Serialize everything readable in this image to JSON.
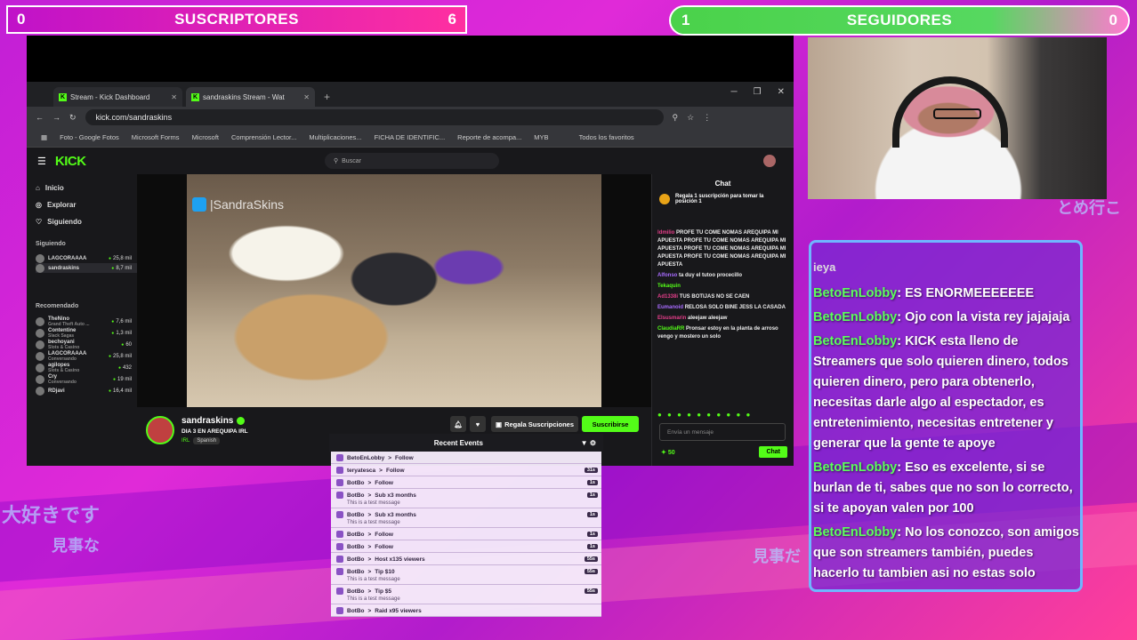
{
  "colors": {
    "kick_green": "#53fc18",
    "overlay_chat_border": "#6fb6ff",
    "username_green": "#5cff5c"
  },
  "counters": {
    "subs": {
      "left": "0",
      "label": "SUSCRIPTORES",
      "right": "6"
    },
    "follows": {
      "left": "1",
      "label": "SEGUIDORES",
      "right": "0"
    }
  },
  "browser": {
    "tabs": [
      {
        "label": "Stream - Kick Dashboard"
      },
      {
        "label": "sandraskins Stream - Wat"
      }
    ],
    "url": "kick.com/sandraskins",
    "bookmarks": [
      "Foto - Google Fotos",
      "Microsoft Forms",
      "Microsoft",
      "Comprensión Lector...",
      "Multiplicaciones...",
      "FICHA DE IDENTIFIC...",
      "Reporte de acompa...",
      "MYB",
      "Todos los favoritos"
    ]
  },
  "kick": {
    "logo": "KICK",
    "search_placeholder": "Buscar",
    "nav": [
      "Inicio",
      "Explorar",
      "Siguiendo"
    ],
    "following_title": "Siguiendo",
    "following": [
      {
        "name": "LAGCORAAAA",
        "count": "25,8 mil"
      },
      {
        "name": "sandraskins",
        "count": "8,7 mil"
      }
    ],
    "recommended_title": "Recomendado",
    "recommended": [
      {
        "name": "TheNino",
        "sub": "Grand Theft Auto ...",
        "count": "7,6 mil"
      },
      {
        "name": "Contentine",
        "sub": "Slack Sagas",
        "count": "1,3 mil"
      },
      {
        "name": "bechoyani",
        "sub": "Slots & Casino",
        "count": "60"
      },
      {
        "name": "LAGCORAAAA",
        "sub": "Conversando",
        "count": "25,8 mil"
      },
      {
        "name": "agilopes",
        "sub": "Slots & Casino",
        "count": "432"
      },
      {
        "name": "Cry",
        "sub": "Conversando",
        "count": "19 mil"
      },
      {
        "name": "RDjavi",
        "sub": "",
        "count": "16,4 mil"
      }
    ],
    "video_watermark": "|SandraSkins",
    "streamer": {
      "name": "sandraskins",
      "title": "DIA 3 EN AREQUIPA IRL",
      "category": "IRL",
      "tag": "Spanish",
      "gift_label": "Regala Suscripciones",
      "subscribe_label": "Suscribirse"
    },
    "chat": {
      "title": "Chat",
      "gift_banner": "Regala 1 suscripción para tomar la posición 1",
      "messages": [
        {
          "user": "ldmilio",
          "text": "PROFE TU COME NOMAS AREQUIPA MI APUESTA PROFE TU COME NOMAS AREQUIPA MI APUESTA PROFE TU COME NOMAS AREQUIPA MI APUESTA PROFE TU COME NOMAS AREQUIPA MI APUESTA"
        },
        {
          "user": "Alfonso",
          "text": "ta duy el tutoo procecillo"
        },
        {
          "user": "Tekaquin",
          "text": ""
        },
        {
          "user": "Ad1338i",
          "text": "TUS BOTIJAS NO SE CAEN"
        },
        {
          "user": "Eumanoid",
          "text": "RELOSA SOLO BINE JESS LA CASADA"
        },
        {
          "user": "Elsusmarin",
          "text": "aleejaw aleejaw"
        },
        {
          "user": "ClaudiaRR",
          "text": "Pronsar estoy en la planta de arroso vengo y mostero un solo"
        }
      ],
      "input_placeholder": "Envía un mensaje",
      "points": "50",
      "send_label": "Chat"
    }
  },
  "events": {
    "title": "Recent Events",
    "items": [
      {
        "user": "BetoEnLobby",
        "action": "Follow",
        "msg": "",
        "ago": ""
      },
      {
        "user": "teryatesca",
        "action": "Follow",
        "msg": "",
        "ago": "31s"
      },
      {
        "user": "BotBo",
        "action": "Follow",
        "msg": "",
        "ago": "1s"
      },
      {
        "user": "BotBo",
        "action": "Sub x3 months",
        "msg": "This is a test message",
        "ago": "1s"
      },
      {
        "user": "BotBo",
        "action": "Sub x3 months",
        "msg": "This is a test message",
        "ago": "1s"
      },
      {
        "user": "BotBo",
        "action": "Follow",
        "msg": "",
        "ago": "1s"
      },
      {
        "user": "BotBo",
        "action": "Follow",
        "msg": "",
        "ago": "1s"
      },
      {
        "user": "BotBo",
        "action": "Host x135 viewers",
        "msg": "",
        "ago": "55s"
      },
      {
        "user": "BotBo",
        "action": "Tip $10",
        "msg": "This is a test message",
        "ago": "55s"
      },
      {
        "user": "BotBo",
        "action": "Tip $5",
        "msg": "This is a test message",
        "ago": "55s"
      },
      {
        "user": "BotBo",
        "action": "Raid x95 viewers",
        "msg": "",
        "ago": ""
      }
    ]
  },
  "overlay_chat": {
    "partial_top": "ieya",
    "messages": [
      {
        "user": "BetoEnLobby",
        "text": ": ES ENORMEEEEEEE"
      },
      {
        "user": "BetoEnLobby",
        "text": ": Ojo con la vista rey jajajaja"
      },
      {
        "user": "BetoEnLobby",
        "text": ": KICK esta lleno de Streamers que solo quieren dinero, todos quieren dinero, pero para obtenerlo, necesitas darle algo al espectador, es entretenimiento, necesitas entretener y generar que la gente te apoye"
      },
      {
        "user": "BetoEnLobby",
        "text": ": Eso es excelente, si se burlan de ti, sabes que no son lo correcto, si te apoyan valen por 100"
      },
      {
        "user": "BetoEnLobby",
        "text": ": No los conozco, son amigos que son streamers también, puedes hacerlo tu tambien asi no estas solo"
      }
    ]
  },
  "background_text": {
    "left1": "大好きです",
    "left2": "見事な",
    "right1": "見事だ",
    "right_top": "とめ行こ"
  }
}
